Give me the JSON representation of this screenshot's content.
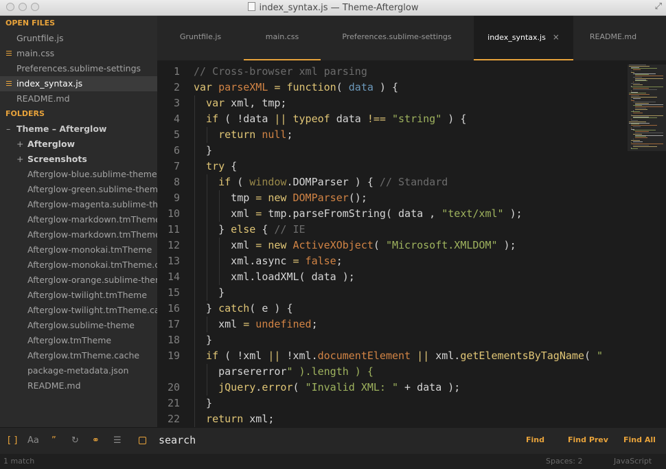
{
  "window": {
    "title": "index_syntax.js — Theme-Afterglow"
  },
  "sidebar": {
    "open_files_header": "OPEN FILES",
    "open_files": [
      {
        "label": "Gruntfile.js"
      },
      {
        "label": "main.css"
      },
      {
        "label": "Preferences.sublime-settings"
      },
      {
        "label": "index_syntax.js"
      },
      {
        "label": "README.md"
      }
    ],
    "folders_header": "FOLDERS",
    "root_folder": "Theme – Afterglow",
    "subfolders": [
      {
        "label": "Afterglow"
      },
      {
        "label": "Screenshots"
      }
    ],
    "files": [
      {
        "label": "Afterglow-blue.sublime-theme"
      },
      {
        "label": "Afterglow-green.sublime-theme"
      },
      {
        "label": "Afterglow-magenta.sublime-theme"
      },
      {
        "label": "Afterglow-markdown.tmTheme"
      },
      {
        "label": "Afterglow-markdown.tmTheme.cache"
      },
      {
        "label": "Afterglow-monokai.tmTheme"
      },
      {
        "label": "Afterglow-monokai.tmTheme.cache"
      },
      {
        "label": "Afterglow-orange.sublime-theme"
      },
      {
        "label": "Afterglow-twilight.tmTheme"
      },
      {
        "label": "Afterglow-twilight.tmTheme.cache"
      },
      {
        "label": "Afterglow.sublime-theme"
      },
      {
        "label": "Afterglow.tmTheme"
      },
      {
        "label": "Afterglow.tmTheme.cache"
      },
      {
        "label": "package-metadata.json"
      },
      {
        "label": "README.md"
      }
    ]
  },
  "tabs": [
    {
      "label": "Gruntfile.js"
    },
    {
      "label": "main.css"
    },
    {
      "label": "Preferences.sublime-settings"
    },
    {
      "label": "index_syntax.js",
      "close": "×"
    },
    {
      "label": "README.md"
    }
  ],
  "editor": {
    "lines": [
      {
        "n": "1",
        "t": "// Cross-browser xml parsing"
      },
      {
        "n": "2",
        "t": "var parseXML = function( data ) {"
      },
      {
        "n": "3",
        "t": "var xml, tmp;"
      },
      {
        "n": "4",
        "t": "if ( !data || typeof data !== \"string\" ) {"
      },
      {
        "n": "5",
        "t": "return null;"
      },
      {
        "n": "6",
        "t": "}"
      },
      {
        "n": "7",
        "t": "try {"
      },
      {
        "n": "8",
        "t": "if ( window.DOMParser ) { // Standard"
      },
      {
        "n": "9",
        "t": "tmp = new DOMParser();"
      },
      {
        "n": "10",
        "t": "xml = tmp.parseFromString( data , \"text/xml\" );"
      },
      {
        "n": "11",
        "t": "} else { // IE"
      },
      {
        "n": "12",
        "t": "xml = new ActiveXObject( \"Microsoft.XMLDOM\" );"
      },
      {
        "n": "13",
        "t": "xml.async = false;"
      },
      {
        "n": "14",
        "t": "xml.loadXML( data );"
      },
      {
        "n": "15",
        "t": "}"
      },
      {
        "n": "16",
        "t": "} catch( e ) {"
      },
      {
        "n": "17",
        "t": "xml = undefined;"
      },
      {
        "n": "18",
        "t": "}"
      },
      {
        "n": "19",
        "t": "if ( !xml || !xml.documentElement || xml.getElementsByTagName( \""
      },
      {
        "n": "",
        "t": "parsererror\" ).length ) {"
      },
      {
        "n": "20",
        "t": "jQuery.error( \"Invalid XML: \" + data );"
      },
      {
        "n": "21",
        "t": "}"
      },
      {
        "n": "22",
        "t": "return xml;"
      }
    ]
  },
  "findbar": {
    "opt_regex": "[ ]",
    "opt_case": "Aa",
    "opt_word": "”",
    "opt_wrap": "↻",
    "opt_selection": "⚭",
    "opt_highlight": "☰",
    "query": "search",
    "find": "Find",
    "find_prev": "Find Prev",
    "find_all": "Find All"
  },
  "status": {
    "matches": "1 match",
    "spaces": "Spaces: 2",
    "syntax": "JavaScript"
  },
  "colors": {
    "accent": "#e8a33b",
    "background": "#1c1c1c",
    "sidebar": "#2b2b2b"
  }
}
